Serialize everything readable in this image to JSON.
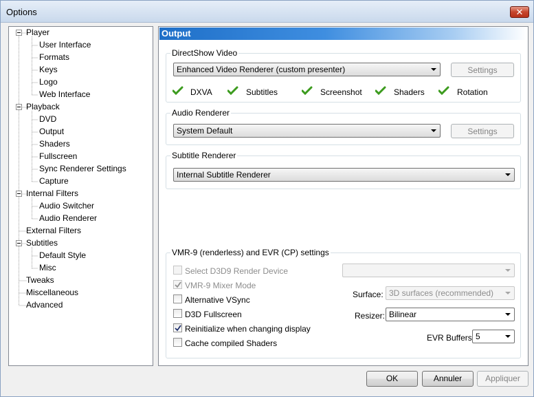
{
  "window": {
    "title": "Options",
    "close_label": "✕"
  },
  "tree": {
    "items": [
      {
        "label": "Player",
        "level": 0,
        "expanded": true
      },
      {
        "label": "User Interface",
        "level": 1
      },
      {
        "label": "Formats",
        "level": 1
      },
      {
        "label": "Keys",
        "level": 1
      },
      {
        "label": "Logo",
        "level": 1
      },
      {
        "label": "Web Interface",
        "level": 1
      },
      {
        "label": "Playback",
        "level": 0,
        "expanded": true
      },
      {
        "label": "DVD",
        "level": 1
      },
      {
        "label": "Output",
        "level": 1
      },
      {
        "label": "Shaders",
        "level": 1
      },
      {
        "label": "Fullscreen",
        "level": 1
      },
      {
        "label": "Sync Renderer Settings",
        "level": 1
      },
      {
        "label": "Capture",
        "level": 1
      },
      {
        "label": "Internal Filters",
        "level": 0,
        "expanded": true
      },
      {
        "label": "Audio Switcher",
        "level": 1
      },
      {
        "label": "Audio Renderer",
        "level": 1
      },
      {
        "label": "External Filters",
        "level": 0
      },
      {
        "label": "Subtitles",
        "level": 0,
        "expanded": true
      },
      {
        "label": "Default Style",
        "level": 1
      },
      {
        "label": "Misc",
        "level": 1
      },
      {
        "label": "Tweaks",
        "level": 0
      },
      {
        "label": "Miscellaneous",
        "level": 0
      },
      {
        "label": "Advanced",
        "level": 0
      }
    ]
  },
  "output": {
    "header": "Output",
    "directshow": {
      "label": "DirectShow Video",
      "renderer": "Enhanced Video Renderer (custom presenter)",
      "settings_label": "Settings",
      "capabilities": [
        "DXVA",
        "Subtitles",
        "Screenshot",
        "Shaders",
        "Rotation"
      ]
    },
    "audio": {
      "label": "Audio Renderer",
      "renderer": "System Default",
      "settings_label": "Settings"
    },
    "subtitle": {
      "label": "Subtitle Renderer",
      "renderer": "Internal Subtitle Renderer"
    },
    "vmr": {
      "label": "VMR-9 (renderless) and EVR (CP) settings",
      "checkboxes": [
        {
          "label": "Select D3D9 Render Device",
          "checked": false,
          "enabled": false
        },
        {
          "label": "VMR-9 Mixer Mode",
          "checked": true,
          "enabled": false
        },
        {
          "label": "Alternative VSync",
          "checked": false,
          "enabled": true
        },
        {
          "label": "D3D Fullscreen",
          "checked": false,
          "enabled": true
        },
        {
          "label": "Reinitialize when changing display",
          "checked": true,
          "enabled": true
        },
        {
          "label": "Cache compiled Shaders",
          "checked": false,
          "enabled": true
        }
      ],
      "device_value": "",
      "surface_label": "Surface:",
      "surface_value": "3D surfaces (recommended)",
      "resizer_label": "Resizer:",
      "resizer_value": "Bilinear",
      "evr_label": "EVR Buffers:",
      "evr_value": "5"
    }
  },
  "buttons": {
    "ok": "OK",
    "cancel": "Annuler",
    "apply": "Appliquer"
  },
  "colors": {
    "header_accent": "#1e6fc8",
    "check_green": "#3c9b1e"
  }
}
